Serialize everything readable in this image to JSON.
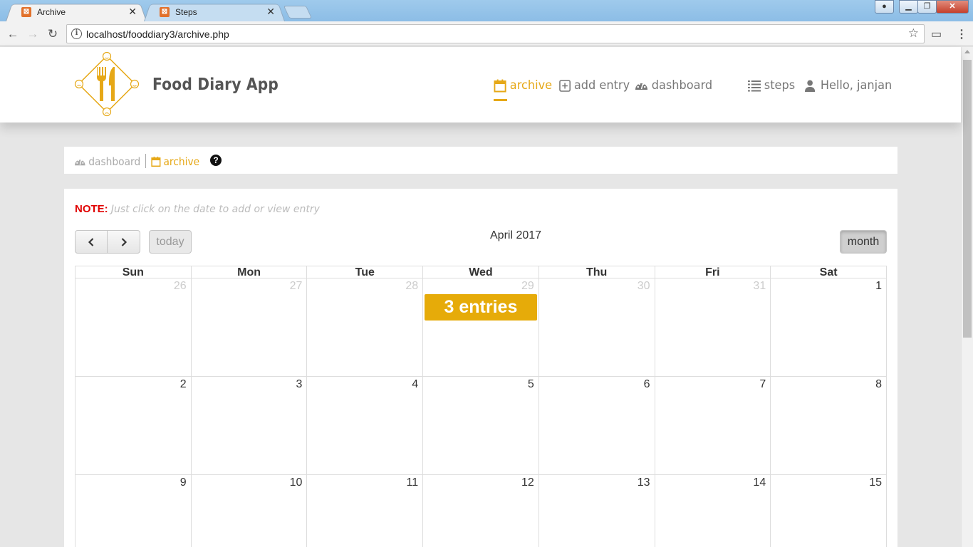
{
  "browser": {
    "tabs": [
      {
        "title": "Archive",
        "active": true
      },
      {
        "title": "Steps",
        "active": false
      }
    ],
    "url": "localhost/fooddiary3/archive.php"
  },
  "app": {
    "brand": "Food Diary App",
    "nav": {
      "archive": "archive",
      "add_entry": "add entry",
      "dashboard": "dashboard",
      "steps": "steps",
      "user": "Hello, janjan"
    },
    "accent_color": "#e6a817"
  },
  "breadcrumb": {
    "dashboard": "dashboard",
    "archive": "archive"
  },
  "calendar": {
    "note_label": "NOTE:",
    "note_text": "Just click on the date to add or view entry",
    "title": "April 2017",
    "today_label": "today",
    "month_label": "month",
    "prev_icon": "chevron-left-icon",
    "next_icon": "chevron-right-icon",
    "weekdays": [
      "Sun",
      "Mon",
      "Tue",
      "Wed",
      "Thu",
      "Fri",
      "Sat"
    ],
    "weeks": [
      [
        "26",
        "27",
        "28",
        "29",
        "30",
        "31",
        "1"
      ],
      [
        "2",
        "3",
        "4",
        "5",
        "6",
        "7",
        "8"
      ],
      [
        "9",
        "10",
        "11",
        "12",
        "13",
        "14",
        "15"
      ]
    ],
    "event": {
      "label": "3 entries",
      "color": "#e6ab09"
    }
  }
}
